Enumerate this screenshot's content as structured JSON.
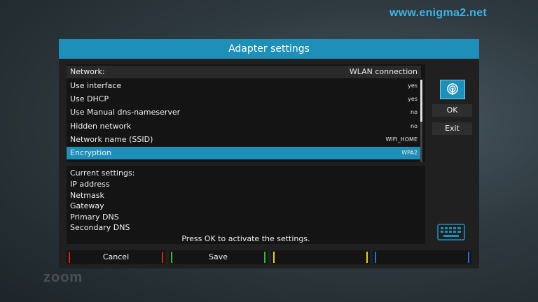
{
  "site": {
    "url": "www.enigma2.net",
    "watermark": "zoom"
  },
  "window": {
    "title": "Adapter settings"
  },
  "network_row": {
    "label": "Network:",
    "value": "WLAN connection"
  },
  "settings": [
    {
      "label": "Use interface",
      "value": "yes"
    },
    {
      "label": "Use DHCP",
      "value": "yes"
    },
    {
      "label": "Use Manual dns-nameserver",
      "value": "no"
    },
    {
      "label": "Hidden network",
      "value": "no"
    },
    {
      "label": "Network name (SSID)",
      "value": "WIFI_HOME"
    },
    {
      "label": "Encryption",
      "value": "WPA2",
      "selected": true
    }
  ],
  "current_settings": {
    "heading": "Current settings:",
    "fields": [
      "IP address",
      "Netmask",
      "Gateway",
      "Primary DNS",
      "Secondary DNS"
    ],
    "hint": "Press OK to activate the settings."
  },
  "side_buttons": {
    "ok": "OK",
    "exit": "Exit",
    "icon": "wifi-signal-icon",
    "keyboard_icon": "keyboard-icon"
  },
  "color_buttons": [
    {
      "label": "Cancel",
      "color": "#e02020"
    },
    {
      "label": "Save",
      "color": "#2ec02e"
    },
    {
      "label": "",
      "color": "#e8d020"
    },
    {
      "label": "",
      "color": "#2070e0"
    }
  ],
  "colors": {
    "accent": "#1e8fb9",
    "url": "#3fb3e6"
  }
}
